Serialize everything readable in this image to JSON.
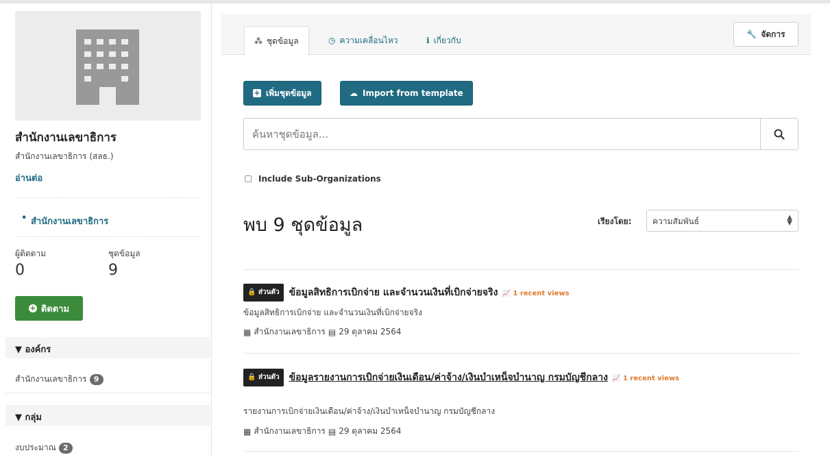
{
  "sidebar": {
    "org_title": "สำนักงานเลขาธิการ",
    "org_subtitle": "สำนักงานเลขาธิการ (สลธ.)",
    "read_more": "อ่านต่อ",
    "org_tree_item": "สำนักงานเลขาธิการ",
    "followers_label": "ผู้ติดตาม",
    "followers_value": "0",
    "datasets_label": "ชุดข้อมูล",
    "datasets_value": "9",
    "follow_button": "ติดตาม",
    "facets": [
      {
        "heading": "องค์กร",
        "items": [
          {
            "label": "สำนักงานเลขาธิการ",
            "count": "9"
          }
        ]
      },
      {
        "heading": "กลุ่ม",
        "items": [
          {
            "label": "งบประมาณ",
            "count": "2"
          }
        ]
      }
    ]
  },
  "main": {
    "tabs": [
      {
        "label": "ชุดข้อมูล",
        "icon": "sitemap-icon",
        "active": true
      },
      {
        "label": "ความเคลื่อนไหว",
        "icon": "clock-icon",
        "active": false
      },
      {
        "label": "เกี่ยวกับ",
        "icon": "info-icon",
        "active": false
      }
    ],
    "manage_button": "จัดการ",
    "add_dataset_button": "เพิ่มชุดข้อมูล",
    "import_button": "Import from template",
    "search": {
      "placeholder": "ค้นหาชุดข้อมูล...",
      "value": ""
    },
    "include_suborgs_label": "Include Sub-Organizations",
    "result_count": "พบ 9 ชุดข้อมูล",
    "sort_label": "เรียงโดย:",
    "sort_value": "ความสัมพันธ์",
    "datasets": [
      {
        "badge": "ส่วนตัว",
        "title": "ข้อมูลสิทธิการเบิกจ่าย และจำนวนเงินที่เบิกจ่ายจริง",
        "views": "1 recent views",
        "description": "ข้อมูลสิทธิการเบิกจ่าย และจำนวนเงินที่เบิกจ่ายจริง",
        "org": "สำนักงานเลขาธิการ",
        "date": "29 ตุลาคม 2564"
      },
      {
        "badge": "ส่วนตัว",
        "title": "ข้อมูลรายงานการเบิกจ่ายเงินเดือน/ค่าจ้าง/เงินบำเหน็จบำนาญ กรมบัญชีกลาง",
        "views": "1 recent views",
        "description": "รายงานการเบิกจ่ายเงินเดือน/ค่าจ้าง/เงินบำเหน็จบำนาญ กรมบัญชีกลาง",
        "org": "สำนักงานเลขาธิการ",
        "date": "29 ตุลาคม 2564"
      }
    ]
  }
}
